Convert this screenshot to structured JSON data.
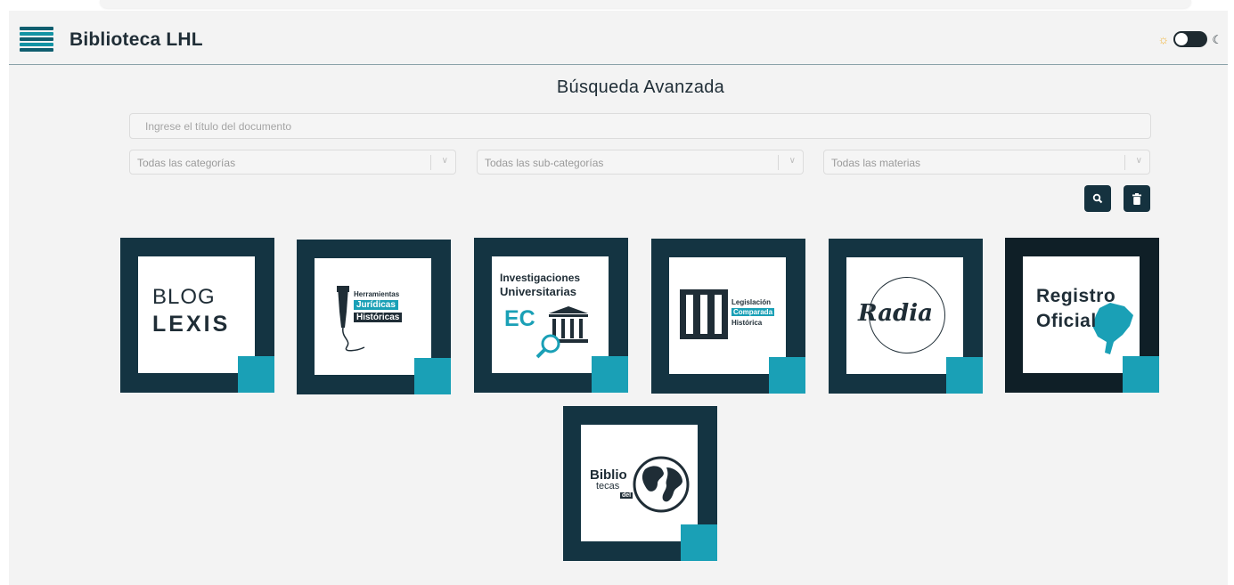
{
  "header": {
    "brand": "Biblioteca LHL",
    "theme_toggle": {
      "state": "light"
    }
  },
  "search": {
    "title": "Búsqueda Avanzada",
    "input_placeholder": "Ingrese el título del documento",
    "category_select": "Todas las categorías",
    "subcategory_select": "Todas las sub-categorías",
    "subject_select": "Todas las materias"
  },
  "cards": {
    "blog_lexis": {
      "line1": "BLOG",
      "line2": "LEXIS"
    },
    "herramientas": {
      "line1": "Herramientas",
      "line2": "Jurídicas",
      "line3": "Históricas"
    },
    "investigaciones": {
      "line1": "Investigaciones",
      "line2": "Universitarias",
      "line3": "EC"
    },
    "legislacion": {
      "line1": "Legislación",
      "line2": "Comparada",
      "line3": "Histórica"
    },
    "radia": {
      "line1": "Radia"
    },
    "registro": {
      "line1": "Registro",
      "line2": "Oficial"
    },
    "bibliotecas": {
      "line1": "Biblio",
      "line2": "tecas",
      "line3": "del"
    }
  },
  "colors": {
    "dark": "#143442",
    "accent": "#1aa0b6",
    "background": "#f3f3f3"
  }
}
